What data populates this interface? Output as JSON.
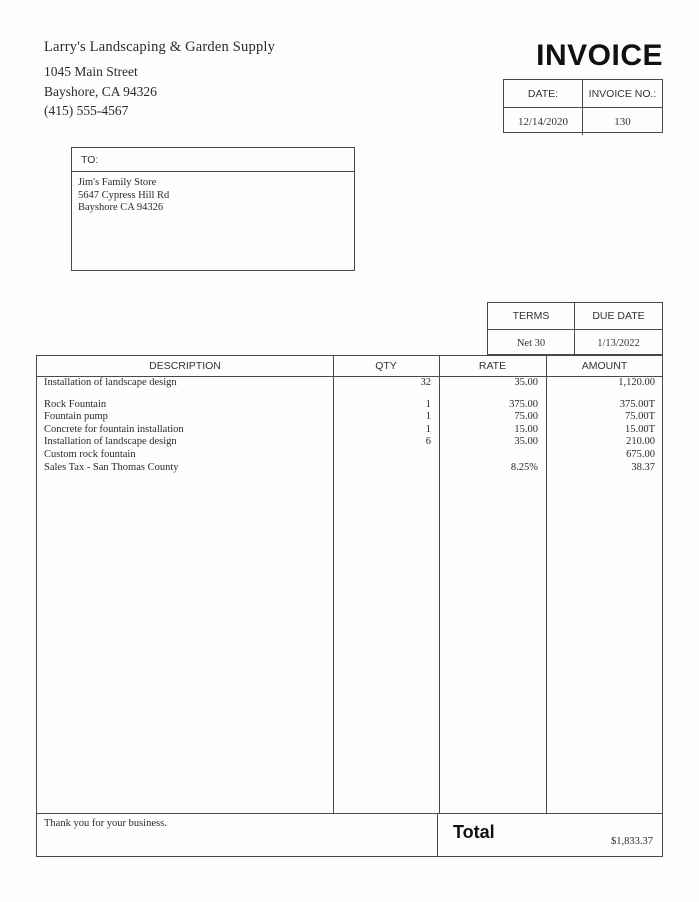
{
  "company": {
    "name": "Larry's Landscaping & Garden Supply",
    "address_lines": [
      "1045 Main Street",
      "Bayshore, CA 94326",
      "(415) 555-4567"
    ]
  },
  "invoice": {
    "title": "INVOICE",
    "date_label": "DATE:",
    "date_value": "12/14/2020",
    "number_label": "INVOICE NO.:",
    "number_value": "130"
  },
  "bill_to": {
    "label": "TO:",
    "lines": [
      "Jim's Family Store",
      "5647 Cypress Hill Rd",
      "Bayshore CA 94326"
    ]
  },
  "terms": {
    "terms_label": "TERMS",
    "terms_value": "Net 30",
    "due_label": "DUE DATE",
    "due_value": "1/13/2022"
  },
  "table": {
    "headers": {
      "description": "DESCRIPTION",
      "qty": "QTY",
      "rate": "RATE",
      "amount": "AMOUNT"
    },
    "rows": [
      {
        "description": "Installation of landscape design",
        "qty": "32",
        "rate": "35.00",
        "amount": "1,120.00"
      },
      {
        "description": "Rock Fountain",
        "qty": "1",
        "rate": "375.00",
        "amount": "375.00T"
      },
      {
        "description": "Fountain pump",
        "qty": "1",
        "rate": "75.00",
        "amount": "75.00T"
      },
      {
        "description": "Concrete for fountain installation",
        "qty": "1",
        "rate": "15.00",
        "amount": "15.00T"
      },
      {
        "description": "Installation of landscape design",
        "qty": "6",
        "rate": "35.00",
        "amount": "210.00"
      },
      {
        "description": "Custom rock fountain",
        "qty": "",
        "rate": "",
        "amount": "675.00"
      },
      {
        "description": "Sales Tax - San Thomas County",
        "qty": "",
        "rate": "8.25%",
        "amount": "38.37"
      }
    ]
  },
  "footer": {
    "thank_you": "Thank you for your business.",
    "total_label": "Total",
    "total_value": "$1,833.37"
  }
}
